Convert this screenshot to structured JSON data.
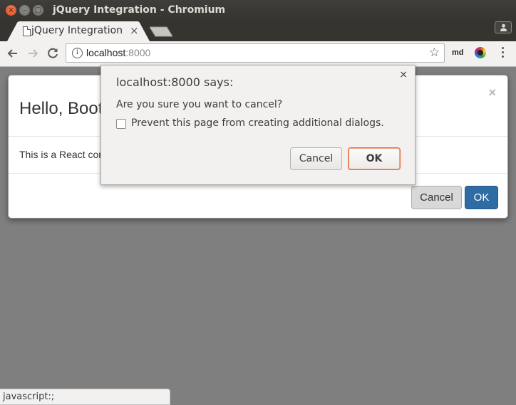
{
  "window": {
    "title": "jQuery Integration - Chromium",
    "controls": {
      "close": "×",
      "minimize": "–",
      "maximize": "□"
    }
  },
  "tabs": [
    {
      "title": "jQuery Integration",
      "close": "×",
      "icon": "page-icon",
      "active": true
    }
  ],
  "toolbar": {
    "url_host": "localhost",
    "url_port": ":8000",
    "extension_label": "md",
    "icons": [
      "back-arrow-icon",
      "forward-arrow-icon",
      "reload-icon",
      "info-icon",
      "star-icon",
      "color-extension-icon",
      "menu-icon"
    ]
  },
  "page_modal": {
    "title": "Hello, Boot",
    "close": "×",
    "body": "This is a React cor",
    "cancel_label": "Cancel",
    "ok_label": "OK",
    "ok_color": "#2e6da4"
  },
  "alert_dialog": {
    "title": "localhost:8000 says:",
    "close": "×",
    "message": "Are you sure you want to cancel?",
    "checkbox_label": "Prevent this page from creating additional dialogs.",
    "checkbox_checked": false,
    "cancel_label": "Cancel",
    "ok_label": "OK",
    "ok_border_color": "#e56b3c"
  },
  "status_bar": {
    "text": "javascript:;"
  }
}
